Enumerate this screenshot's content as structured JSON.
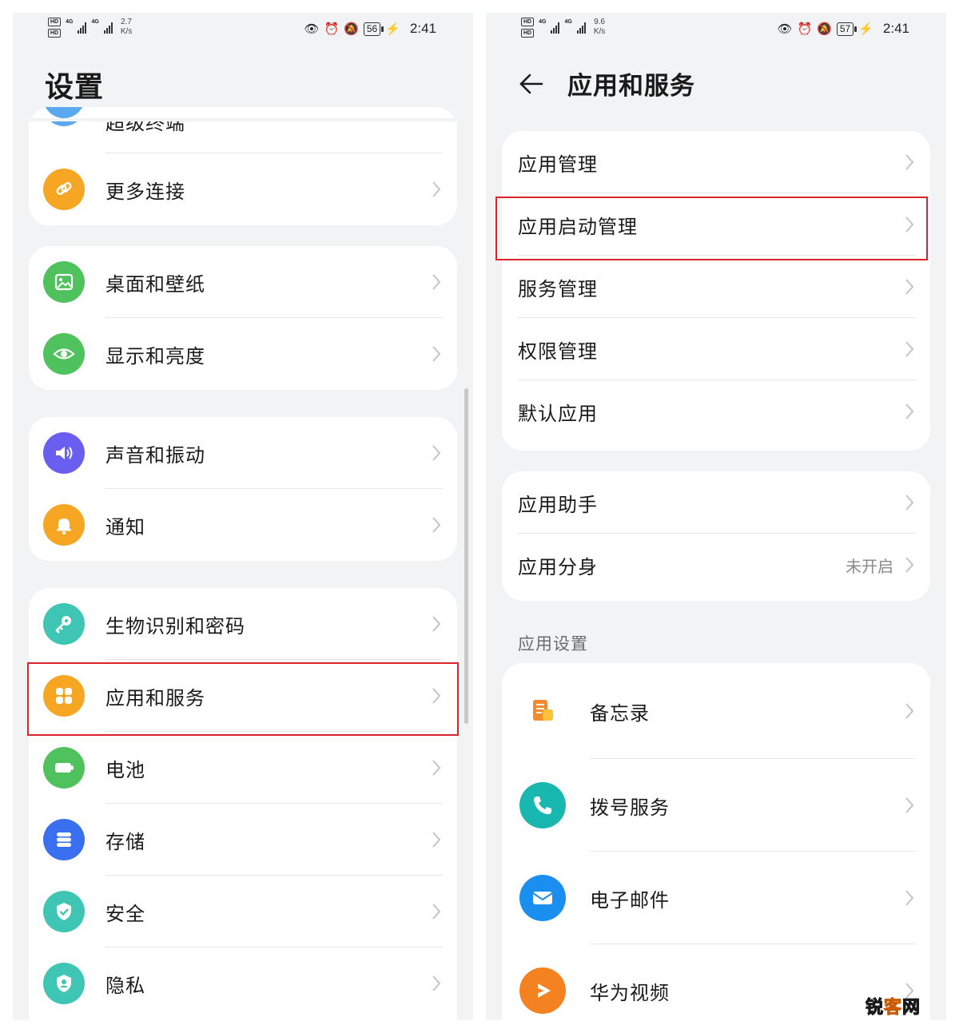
{
  "left_screen": {
    "status": {
      "hd1": "HD",
      "hd2": "HD",
      "net1": "4G",
      "net2": "4G",
      "speed_value": "2.7",
      "speed_unit": "K/s",
      "battery": "56",
      "time": "2:41"
    },
    "title": "设置",
    "groups": [
      {
        "items": [
          {
            "label": "超级终端",
            "icon": "super-device-icon",
            "color": "#5aa9f0"
          },
          {
            "label": "更多连接",
            "icon": "link-icon",
            "color": "#f6a623"
          }
        ]
      },
      {
        "items": [
          {
            "label": "桌面和壁纸",
            "icon": "wallpaper-icon",
            "color": "#4fc25e"
          },
          {
            "label": "显示和亮度",
            "icon": "eye-icon",
            "color": "#4fc25e"
          }
        ]
      },
      {
        "items": [
          {
            "label": "声音和振动",
            "icon": "speaker-icon",
            "color": "#6a5ef0"
          },
          {
            "label": "通知",
            "icon": "bell-icon",
            "color": "#f6a623"
          }
        ]
      },
      {
        "items": [
          {
            "label": "生物识别和密码",
            "icon": "key-icon",
            "color": "#3fc5b3"
          },
          {
            "label": "应用和服务",
            "icon": "apps-grid-icon",
            "color": "#f6a623"
          },
          {
            "label": "电池",
            "icon": "battery-icon",
            "color": "#4fc25e"
          },
          {
            "label": "存储",
            "icon": "storage-icon",
            "color": "#3a6ff0"
          },
          {
            "label": "安全",
            "icon": "shield-icon",
            "color": "#3fc5b3"
          },
          {
            "label": "隐私",
            "icon": "privacy-icon",
            "color": "#3fc5b3"
          }
        ]
      }
    ]
  },
  "right_screen": {
    "status": {
      "hd1": "HD",
      "hd2": "HD",
      "net1": "4G",
      "net2": "4G",
      "speed_value": "9.6",
      "speed_unit": "K/s",
      "battery": "57",
      "time": "2:41"
    },
    "title": "应用和服务",
    "group1": [
      "应用管理",
      "应用启动管理",
      "服务管理",
      "权限管理",
      "默认应用"
    ],
    "group2": [
      {
        "label": "应用助手",
        "value": ""
      },
      {
        "label": "应用分身",
        "value": "未开启"
      }
    ],
    "section_title": "应用设置",
    "apps": [
      {
        "label": "备忘录",
        "icon": "notepad-icon",
        "color": "#f28b2e"
      },
      {
        "label": "拨号服务",
        "icon": "phone-icon",
        "color": "#18b8b0"
      },
      {
        "label": "电子邮件",
        "icon": "mail-icon",
        "color": "#1a8ff0"
      },
      {
        "label": "华为视频",
        "icon": "video-play-icon",
        "color": "#f58220"
      }
    ]
  },
  "highlight_color": "#d9242c",
  "watermark": {
    "part1": "锐",
    "part2": "客",
    "part3": "网"
  }
}
